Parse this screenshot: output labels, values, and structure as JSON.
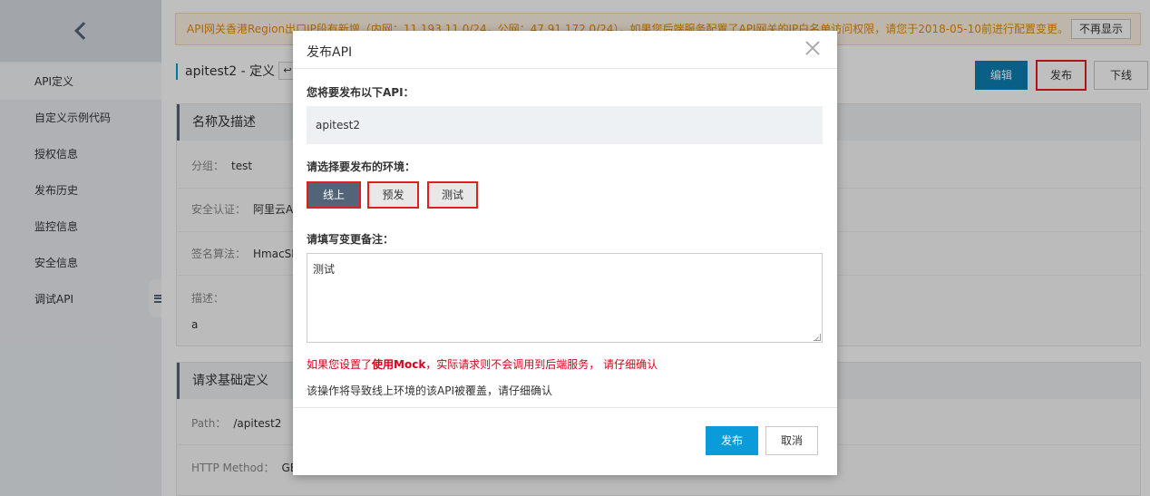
{
  "sidebar": {
    "items": [
      {
        "label": "API定义",
        "active": true
      },
      {
        "label": "自定义示例代码"
      },
      {
        "label": "授权信息"
      },
      {
        "label": "发布历史"
      },
      {
        "label": "监控信息"
      },
      {
        "label": "安全信息"
      },
      {
        "label": "调试API"
      }
    ]
  },
  "notice": {
    "text": "API网关香港Region出口IP段有新增（内网：11.193.11.0/24，公网：47.91.172.0/24），如果您后端服务配置了API网关的IP白名单访问权限，请您于2018-05-10前进行配置变更。 ...",
    "dismiss_label": "不再显示"
  },
  "header": {
    "title": "apitest2 - 定义",
    "edit_label": "编辑",
    "publish_label": "发布",
    "offline_label": "下线"
  },
  "section_basic": {
    "title": "名称及描述",
    "group_label": "分组：",
    "group_value": "test",
    "auth_label": "安全认证：",
    "auth_value": "阿里云A",
    "sign_label": "签名算法：",
    "sign_value": "HmacSH",
    "desc_label": "描述：",
    "desc_value": "a"
  },
  "section_request": {
    "title": "请求基础定义",
    "path_label": "Path：",
    "path_value": "/apitest2",
    "method_label": "HTTP Method：",
    "method_value": "GE"
  },
  "modal": {
    "title": "发布API",
    "api_label": "您将要发布以下API：",
    "api_name": "apitest2",
    "env_label": "请选择要发布的环境：",
    "env_online": "线上",
    "env_pre": "预发",
    "env_test": "测试",
    "remark_label": "请填写变更备注：",
    "remark_value": "测试",
    "warn_prefix": "如果您设置了",
    "warn_bold": "使用Mock",
    "warn_suffix": "，实际请求则不会调用到后端服务， 请仔细确认",
    "info": "该操作将导致线上环境的该API被覆盖，请仔细确认",
    "confirm_label": "发布",
    "cancel_label": "取消"
  }
}
